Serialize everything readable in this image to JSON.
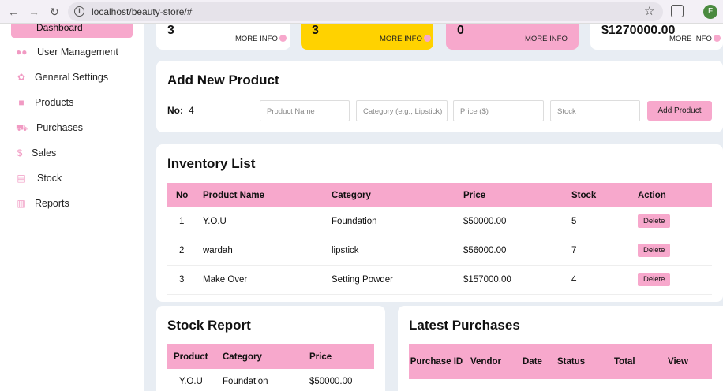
{
  "browser": {
    "url": "localhost/beauty-store/#",
    "profile_initial": "F"
  },
  "sidebar": {
    "active_label": "Dashboard",
    "items": [
      {
        "label": "User Management",
        "icon": "users-icon"
      },
      {
        "label": "General Settings",
        "icon": "gear-icon"
      },
      {
        "label": "Products",
        "icon": "box-icon"
      },
      {
        "label": "Purchases",
        "icon": "cart-icon"
      },
      {
        "label": "Sales",
        "icon": "dollar-icon"
      },
      {
        "label": "Stock",
        "icon": "warehouse-icon"
      },
      {
        "label": "Reports",
        "icon": "chart-icon"
      }
    ]
  },
  "stats": [
    {
      "value": "3",
      "more": "MORE INFO",
      "color": "#ffffff"
    },
    {
      "value": "3",
      "more": "MORE INFO",
      "color": "#ffd200"
    },
    {
      "value": "0",
      "more": "MORE INFO",
      "color": "#f7a8cc"
    },
    {
      "value": "$1270000.00",
      "more": "MORE INFO",
      "color": "#ffffff"
    }
  ],
  "add_product": {
    "title": "Add New Product",
    "no_label": "No:",
    "no_value": "4",
    "name_placeholder": "Product Name",
    "category_placeholder": "Category (e.g., Lipstick)",
    "price_placeholder": "Price ($)",
    "stock_placeholder": "Stock",
    "button": "Add Product"
  },
  "inventory": {
    "title": "Inventory List",
    "headers": [
      "No",
      "Product Name",
      "Category",
      "Price",
      "Stock",
      "Action"
    ],
    "rows": [
      {
        "no": "1",
        "name": "Y.O.U",
        "category": "Foundation",
        "price": "$50000.00",
        "stock": "5",
        "action": "Delete"
      },
      {
        "no": "2",
        "name": "wardah",
        "category": "lipstick",
        "price": "$56000.00",
        "stock": "7",
        "action": "Delete"
      },
      {
        "no": "3",
        "name": "Make Over",
        "category": "Setting Powder",
        "price": "$157000.00",
        "stock": "4",
        "action": "Delete"
      }
    ]
  },
  "stock_report": {
    "title": "Stock Report",
    "headers": [
      "Product",
      "Category",
      "Price"
    ],
    "rows": [
      {
        "product": "Y.O.U",
        "category": "Foundation",
        "price": "$50000.00"
      }
    ]
  },
  "latest_purchases": {
    "title": "Latest Purchases",
    "headers": [
      "Purchase ID",
      "Vendor",
      "Date",
      "Status",
      "Total",
      "View"
    ]
  },
  "colors": {
    "accent": "#f7a8cc",
    "yellow": "#ffd200"
  }
}
